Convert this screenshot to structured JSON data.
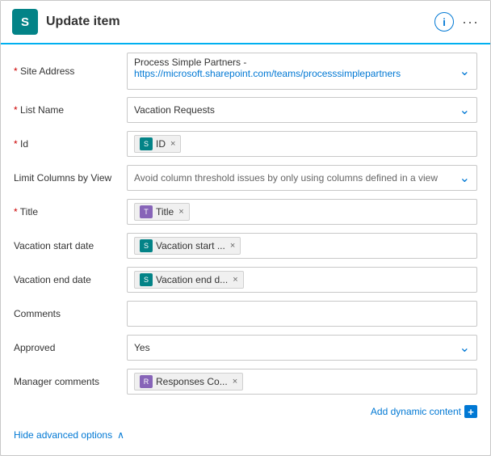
{
  "header": {
    "icon_letter": "S",
    "title": "Update item",
    "info_icon": "ℹ",
    "more_icon": "···"
  },
  "fields": [
    {
      "id": "site-address",
      "label": "* Site Address",
      "required": true,
      "type": "dropdown-multiline",
      "value_top": "Process Simple Partners -",
      "value_link": "https://microsoft.sharepoint.com/teams/processsimplepartners"
    },
    {
      "id": "list-name",
      "label": "* List Name",
      "required": true,
      "type": "dropdown",
      "value": "Vacation Requests"
    },
    {
      "id": "id",
      "label": "* Id",
      "required": true,
      "type": "token",
      "tokens": [
        {
          "icon_type": "teal",
          "icon_text": "S",
          "label": "ID"
        }
      ]
    },
    {
      "id": "limit-columns",
      "label": "Limit Columns by View",
      "required": false,
      "type": "dropdown",
      "value": "Avoid column threshold issues by only using columns defined in a view"
    },
    {
      "id": "title",
      "label": "* Title",
      "required": true,
      "type": "token",
      "tokens": [
        {
          "icon_type": "purple",
          "icon_text": "T",
          "label": "Title"
        }
      ]
    },
    {
      "id": "vacation-start",
      "label": "Vacation start date",
      "required": false,
      "type": "token",
      "tokens": [
        {
          "icon_type": "teal",
          "icon_text": "S",
          "label": "Vacation start ..."
        }
      ]
    },
    {
      "id": "vacation-end",
      "label": "Vacation end date",
      "required": false,
      "type": "token",
      "tokens": [
        {
          "icon_type": "teal",
          "icon_text": "S",
          "label": "Vacation end d..."
        }
      ]
    },
    {
      "id": "comments",
      "label": "Comments",
      "required": false,
      "type": "empty"
    },
    {
      "id": "approved",
      "label": "Approved",
      "required": false,
      "type": "dropdown",
      "value": "Yes"
    },
    {
      "id": "manager-comments",
      "label": "Manager comments",
      "required": false,
      "type": "token",
      "tokens": [
        {
          "icon_type": "purple",
          "icon_text": "R",
          "label": "Responses Co..."
        }
      ]
    }
  ],
  "add_dynamic_label": "Add dynamic content",
  "hide_advanced_label": "Hide advanced options"
}
